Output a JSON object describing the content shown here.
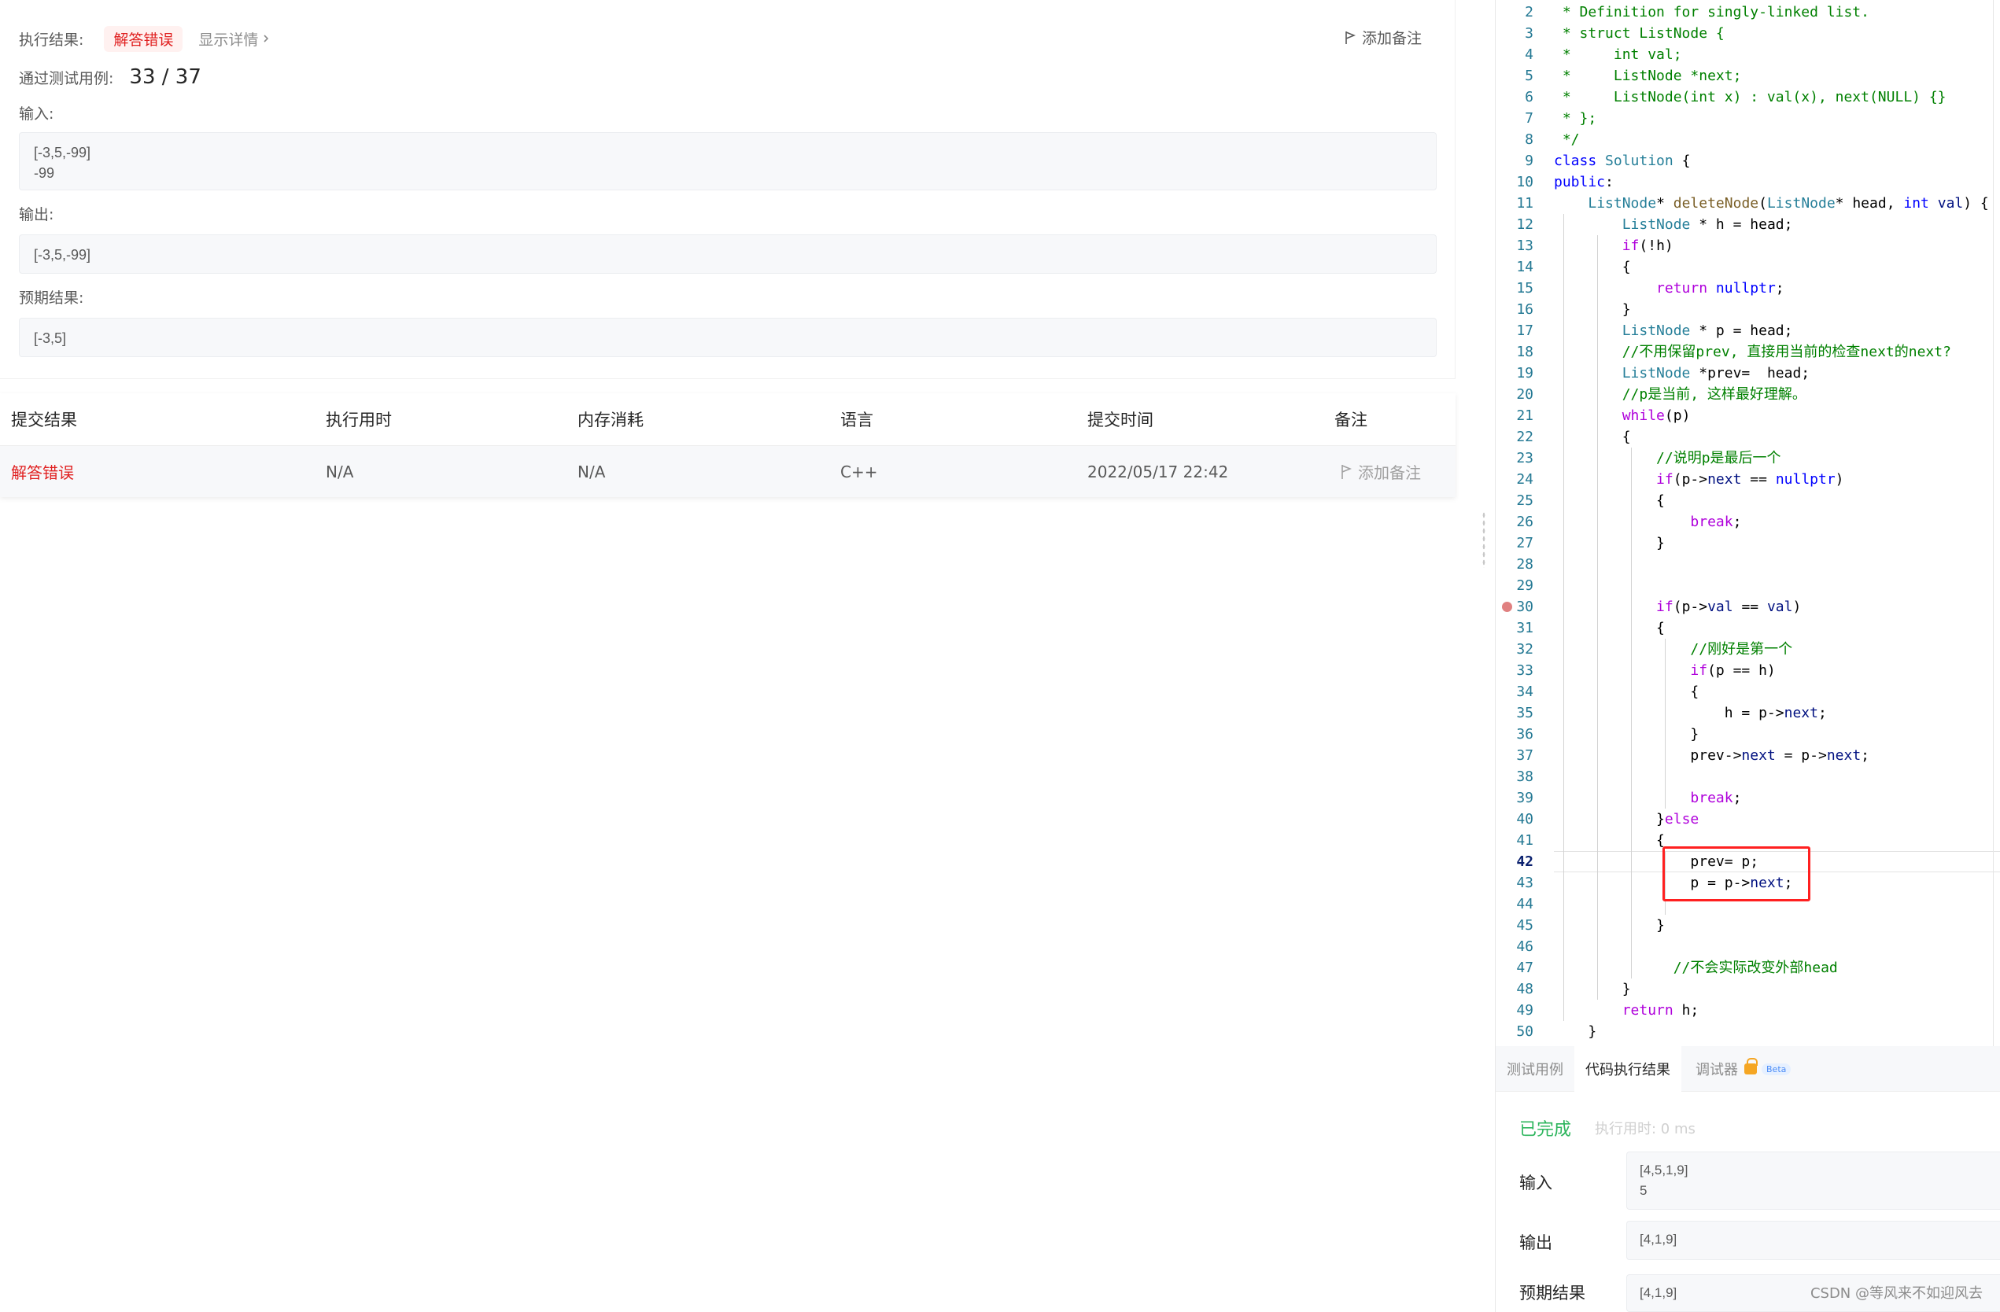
{
  "result": {
    "exec_label": "执行结果:",
    "status": "解答错误",
    "detail_link": "显示详情",
    "add_note": "添加备注",
    "pass_label": "通过测试用例:",
    "pass_count": "33 / 37",
    "input_label": "输入:",
    "input_value": "[-3,5,-99]\n-99",
    "output_label": "输出:",
    "output_value": "[-3,5,-99]",
    "expected_label": "预期结果:",
    "expected_value": "[-3,5]"
  },
  "submissions": {
    "headers": [
      "提交结果",
      "执行用时",
      "内存消耗",
      "语言",
      "提交时间",
      "备注"
    ],
    "rows": [
      {
        "result": "解答错误",
        "runtime": "N/A",
        "memory": "N/A",
        "language": "C++",
        "time": "2022/05/17 22:42",
        "note": "添加备注"
      }
    ]
  },
  "code": {
    "active_line": "42",
    "breakpoint_line": "30",
    "lines": [
      {
        "n": "2",
        "t": " * Definition for singly-linked list."
      },
      {
        "n": "3",
        "t": " * struct ListNode {"
      },
      {
        "n": "4",
        "t": " *     int val;"
      },
      {
        "n": "5",
        "t": " *     ListNode *next;"
      },
      {
        "n": "6",
        "t": " *     ListNode(int x) : val(x), next(NULL) {}"
      },
      {
        "n": "7",
        "t": " * };"
      },
      {
        "n": "8",
        "t": " */"
      },
      {
        "n": "9",
        "t": "class Solution {"
      },
      {
        "n": "10",
        "t": "public:"
      },
      {
        "n": "11",
        "t": "    ListNode* deleteNode(ListNode* head, int val) {"
      },
      {
        "n": "12",
        "t": "        ListNode * h = head;"
      },
      {
        "n": "13",
        "t": "        if(!h)"
      },
      {
        "n": "14",
        "t": "        {"
      },
      {
        "n": "15",
        "t": "            return nullptr;"
      },
      {
        "n": "16",
        "t": "        }"
      },
      {
        "n": "17",
        "t": "        ListNode * p = head;"
      },
      {
        "n": "18",
        "t": "        //不用保留prev, 直接用当前的检查next的next?"
      },
      {
        "n": "19",
        "t": "        ListNode *prev=  head;"
      },
      {
        "n": "20",
        "t": "        //p是当前, 这样最好理解。"
      },
      {
        "n": "21",
        "t": "        while(p)"
      },
      {
        "n": "22",
        "t": "        {"
      },
      {
        "n": "23",
        "t": "            //说明p是最后一个"
      },
      {
        "n": "24",
        "t": "            if(p->next == nullptr)"
      },
      {
        "n": "25",
        "t": "            {"
      },
      {
        "n": "26",
        "t": "                break;"
      },
      {
        "n": "27",
        "t": "            }"
      },
      {
        "n": "28",
        "t": ""
      },
      {
        "n": "29",
        "t": ""
      },
      {
        "n": "30",
        "t": "            if(p->val == val)"
      },
      {
        "n": "31",
        "t": "            {"
      },
      {
        "n": "32",
        "t": "                //刚好是第一个"
      },
      {
        "n": "33",
        "t": "                if(p == h)"
      },
      {
        "n": "34",
        "t": "                {"
      },
      {
        "n": "35",
        "t": "                    h = p->next;"
      },
      {
        "n": "36",
        "t": "                }"
      },
      {
        "n": "37",
        "t": "                prev->next = p->next;"
      },
      {
        "n": "38",
        "t": ""
      },
      {
        "n": "39",
        "t": "                break;"
      },
      {
        "n": "40",
        "t": "            }else"
      },
      {
        "n": "41",
        "t": "            {"
      },
      {
        "n": "42",
        "t": "                prev= p;"
      },
      {
        "n": "43",
        "t": "                p = p->next;"
      },
      {
        "n": "44",
        "t": ""
      },
      {
        "n": "45",
        "t": "            }"
      },
      {
        "n": "46",
        "t": ""
      },
      {
        "n": "47",
        "t": "              //不会实际改变外部head"
      },
      {
        "n": "48",
        "t": "        }"
      },
      {
        "n": "49",
        "t": "        return h;"
      },
      {
        "n": "50",
        "t": "    }"
      }
    ]
  },
  "console": {
    "tabs": [
      "测试用例",
      "代码执行结果",
      "调试器"
    ],
    "beta": "Beta",
    "status": "已完成",
    "runtime": "执行用时: 0 ms",
    "input_label": "输入",
    "input_value": "[4,5,1,9]\n5",
    "output_label": "输出",
    "output_value": "[4,1,9]",
    "expected_label": "预期结果",
    "expected_value": "[4,1,9]"
  },
  "watermark": "CSDN @等风来不如迎风去",
  "colors": {
    "error": "#e02020",
    "success": "#2db55d",
    "highlight_box": "#ff2020"
  }
}
